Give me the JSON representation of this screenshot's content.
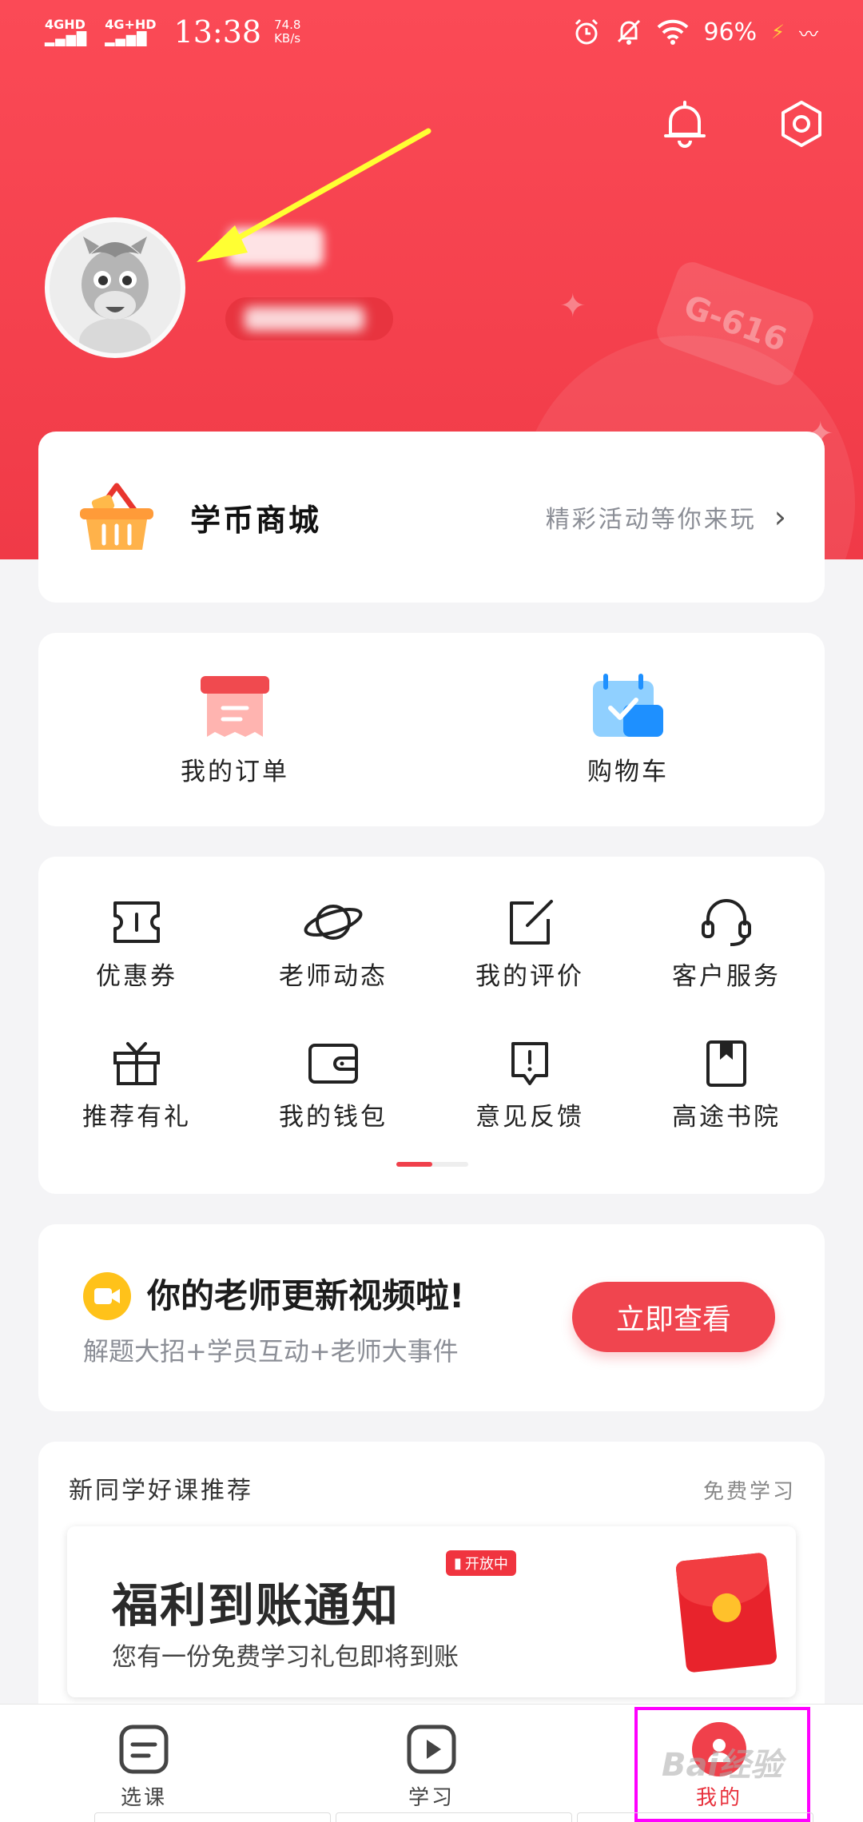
{
  "status_bar": {
    "signal1": "4GHD",
    "signal2": "4G+HD",
    "time": "13:38",
    "speed_value": "74.8",
    "speed_unit": "KB/s",
    "battery": "96%"
  },
  "hero": {
    "deco_sign": "G-616"
  },
  "mall": {
    "title": "学币商城",
    "subtitle": "精彩活动等你来玩"
  },
  "orders": [
    {
      "label": "我的订单"
    },
    {
      "label": "购物车"
    }
  ],
  "grid": {
    "row1": [
      {
        "label": "优惠券",
        "icon": "ticket-icon"
      },
      {
        "label": "老师动态",
        "icon": "planet-icon"
      },
      {
        "label": "我的评价",
        "icon": "edit-icon"
      },
      {
        "label": "客户服务",
        "icon": "headset-icon"
      }
    ],
    "row2": [
      {
        "label": "推荐有礼",
        "icon": "gift-icon"
      },
      {
        "label": "我的钱包",
        "icon": "wallet-icon"
      },
      {
        "label": "意见反馈",
        "icon": "feedback-icon"
      },
      {
        "label": "高途书院",
        "icon": "book-icon"
      }
    ]
  },
  "teacher_update": {
    "title": "你的老师更新视频啦!",
    "subtitle": "解题大招+学员互动+老师大事件",
    "button": "立即查看"
  },
  "recommend": {
    "title": "新同学好课推荐",
    "more": "免费学习",
    "banner_title": "福利到账通知",
    "banner_tag": "开放中",
    "banner_sub": "您有一份免费学习礼包即将到账"
  },
  "tabbar": {
    "tab1": "选课",
    "tab2": "学习",
    "tab3": "我的"
  },
  "watermark": "Bai经验",
  "colors": {
    "brand_red": "#f0404b",
    "annotation_arrow": "#ffff33",
    "annotation_box": "#ff00ff"
  }
}
